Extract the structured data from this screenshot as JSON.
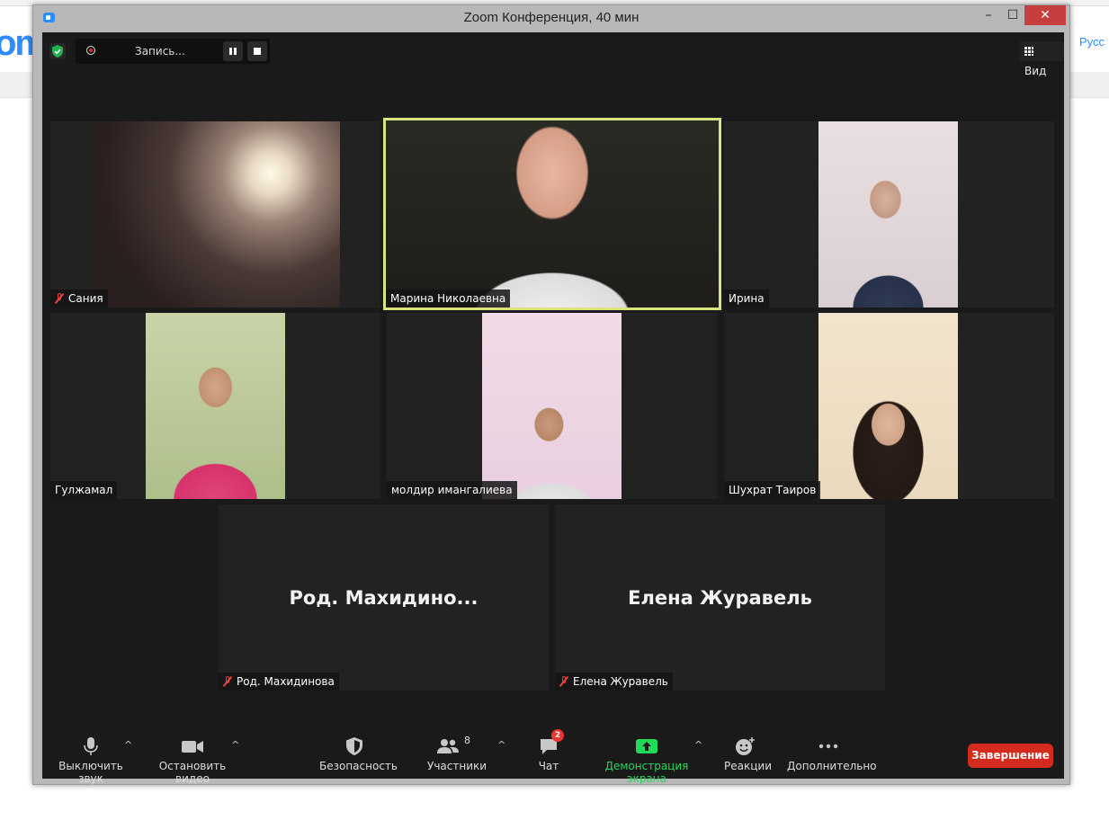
{
  "browser": {
    "logo_text": "om",
    "lang_link": "Русс"
  },
  "window": {
    "title": "Zoom Конференция, 40 мин",
    "min_glyph": "–",
    "max_glyph": "☐",
    "close_glyph": "✕"
  },
  "topbar": {
    "recording_label": "Запись...",
    "view_label": "Вид"
  },
  "tiles": [
    {
      "name": "Сания",
      "muted": true,
      "active": false
    },
    {
      "name": "Марина Николаевна",
      "muted": false,
      "active": true
    },
    {
      "name": "Ирина",
      "muted": false,
      "active": false
    },
    {
      "name": "Гулжамал",
      "muted": false,
      "active": false
    },
    {
      "name": "молдир имангалиева",
      "muted": false,
      "active": false
    },
    {
      "name": "Шухрат Таиров",
      "muted": false,
      "active": false
    },
    {
      "name": "Род. Махидинова",
      "display_name": "Род.  Махидино...",
      "muted": true,
      "active": false
    },
    {
      "name": "Елена Журавель",
      "display_name": "Елена Журавель",
      "muted": true,
      "active": false
    }
  ],
  "toolbar": {
    "mute_label": "Выключить звук",
    "video_label": "Остановить видео",
    "security_label": "Безопасность",
    "participants_label": "Участники",
    "participants_count": "8",
    "chat_label": "Чат",
    "chat_badge": "2",
    "share_label": "Демонстрация экрана",
    "reactions_label": "Реакции",
    "more_label": "Дополнительно",
    "end_label": "Завершение",
    "caret": "^"
  },
  "colors": {
    "active_speaker_border": "#d9e37f",
    "share_green": "#23d959",
    "end_red": "#d52b1e",
    "muted_red": "#e8453c"
  }
}
